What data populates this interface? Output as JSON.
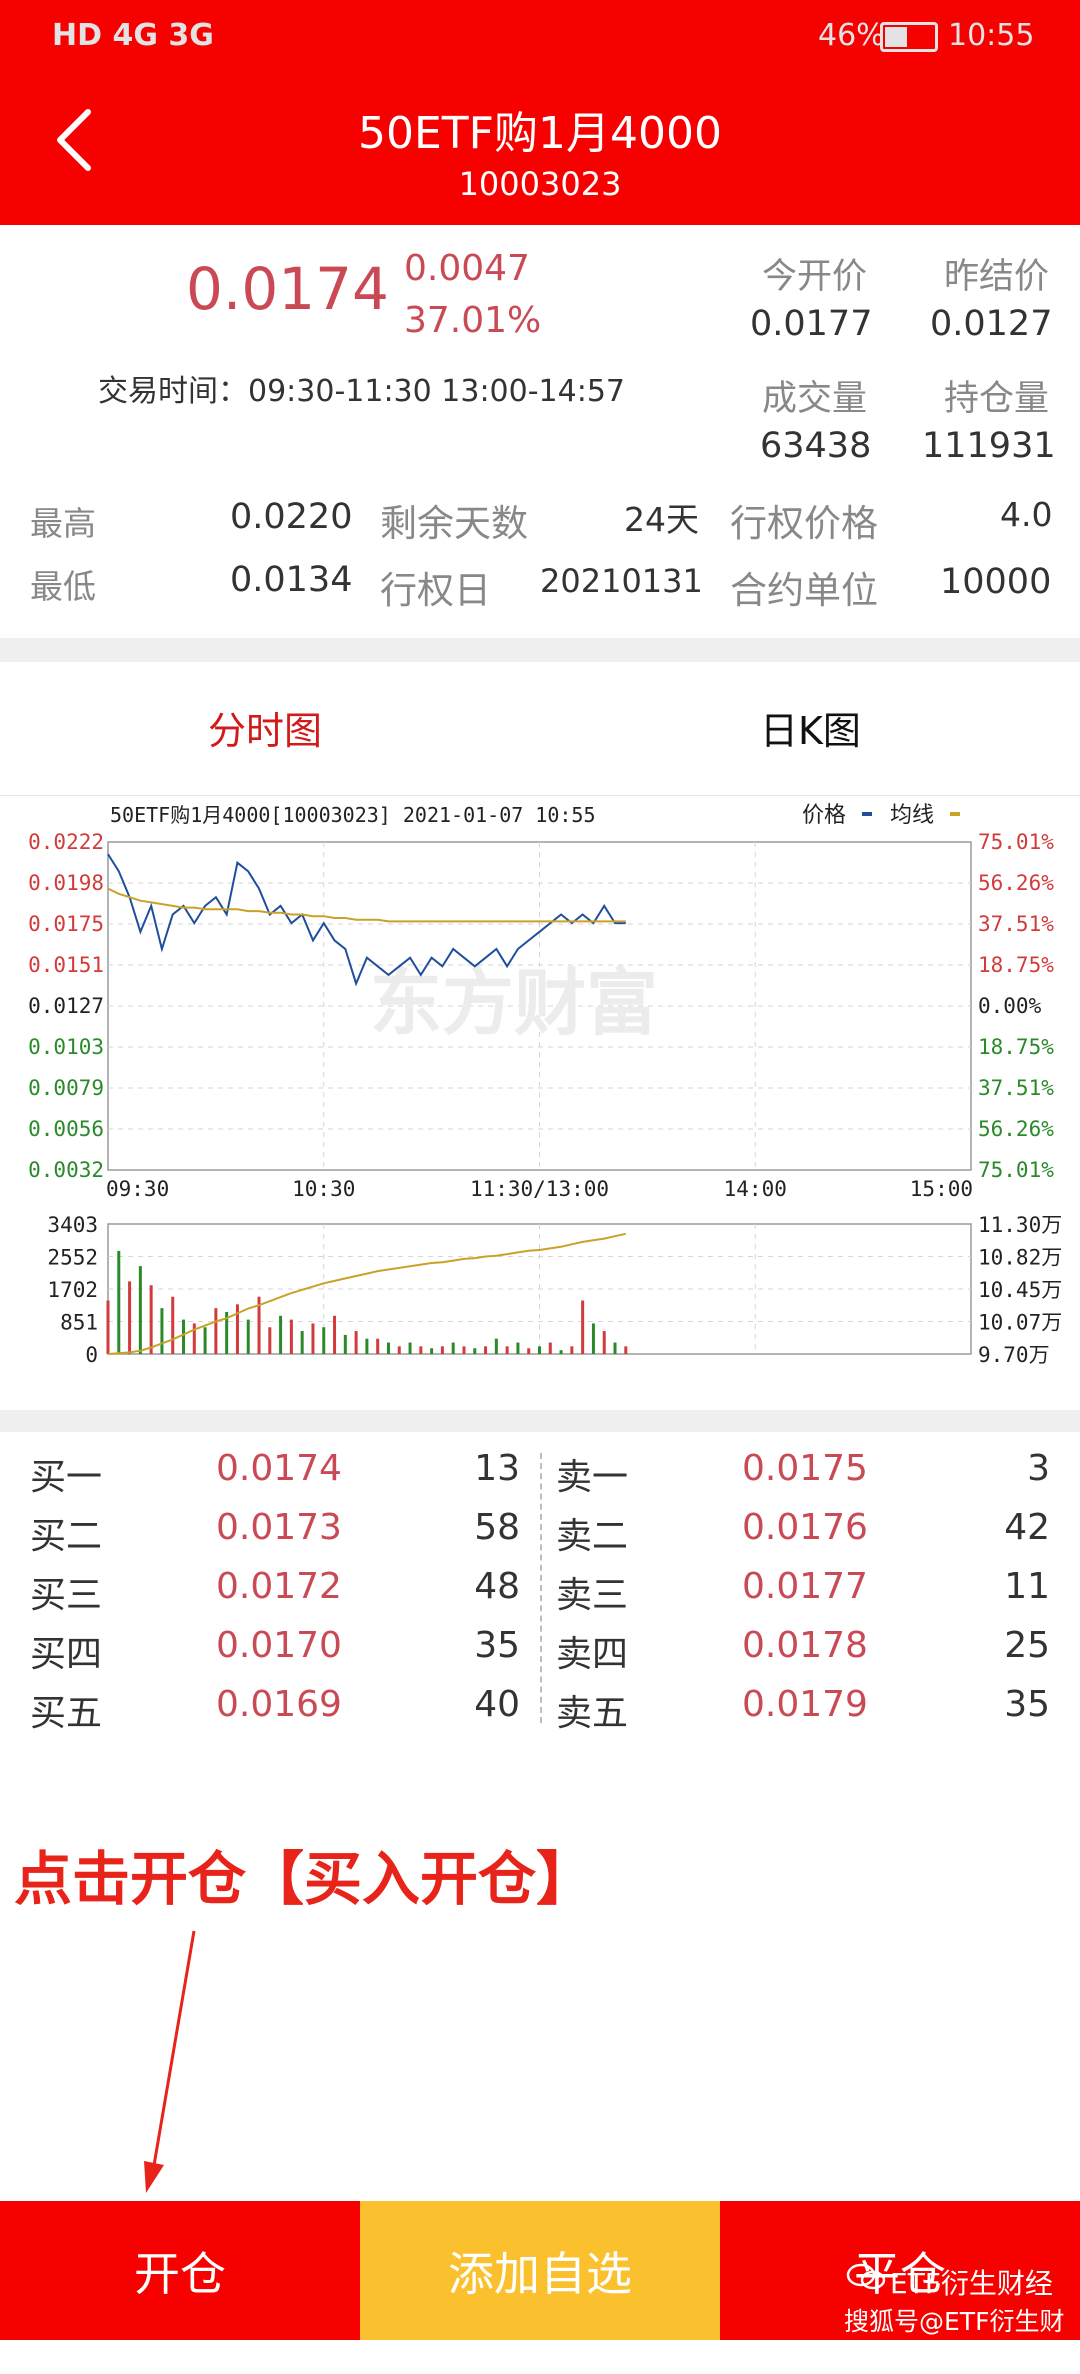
{
  "status_bar": {
    "signals": "HD 4G 3G",
    "battery": "46%",
    "time": "10:55"
  },
  "header": {
    "title": "50ETF购1月4000",
    "code": "10003023"
  },
  "quote": {
    "price": "0.0174",
    "change": "0.0047",
    "change_pct": "37.01%",
    "trade_time": "交易时间：09:30-11:30 13:00-14:57",
    "open_label": "今开价",
    "open_value": "0.0177",
    "prev_settle_label": "昨结价",
    "prev_settle_value": "0.0127",
    "volume_label": "成交量",
    "volume_value": "63438",
    "open_interest_label": "持仓量",
    "open_interest_value": "111931"
  },
  "details": {
    "high_label": "最高",
    "high_value": "0.0220",
    "low_label": "最低",
    "low_value": "0.0134",
    "days_left_label": "剩余天数",
    "days_left_value": "24天",
    "exercise_date_label": "行权日",
    "exercise_date_value": "20210131",
    "strike_label": "行权价格",
    "strike_value": "4.0",
    "unit_label": "合约单位",
    "unit_value": "10000"
  },
  "tabs": {
    "intraday": "分时图",
    "daily_k": "日K图"
  },
  "chart_header": {
    "title": "50ETF购1月4000[10003023] 2021-01-07 10:55",
    "legend_price": "价格",
    "legend_avg": "均线"
  },
  "chart_data": {
    "type": "line",
    "watermark": "东方财富",
    "x_ticks": [
      "09:30",
      "10:30",
      "11:30/13:00",
      "14:00",
      "15:00"
    ],
    "y_left_ticks": [
      "0.0222",
      "0.0198",
      "0.0175",
      "0.0151",
      "0.0127",
      "0.0103",
      "0.0079",
      "0.0056",
      "0.0032"
    ],
    "y_right_ticks": [
      "75.01%",
      "56.26%",
      "37.51%",
      "18.75%",
      "0.00%",
      "18.75%",
      "37.51%",
      "56.26%",
      "75.01%"
    ],
    "ylim": [
      0.0032,
      0.0222
    ],
    "series": [
      {
        "name": "价格",
        "color": "#1f4e9c",
        "values": [
          0.0215,
          0.0205,
          0.019,
          0.017,
          0.0185,
          0.016,
          0.018,
          0.0185,
          0.0175,
          0.0185,
          0.019,
          0.018,
          0.021,
          0.0205,
          0.0195,
          0.018,
          0.0185,
          0.0175,
          0.018,
          0.0165,
          0.0175,
          0.0165,
          0.016,
          0.014,
          0.0155,
          0.015,
          0.0145,
          0.015,
          0.0155,
          0.0145,
          0.0155,
          0.015,
          0.016,
          0.0155,
          0.015,
          0.0155,
          0.016,
          0.015,
          0.016,
          0.0165,
          0.017,
          0.0175,
          0.018,
          0.0175,
          0.018,
          0.0175,
          0.0185,
          0.0175,
          0.0175
        ]
      },
      {
        "name": "均线",
        "color": "#c9a227",
        "values": [
          0.0195,
          0.0192,
          0.019,
          0.0188,
          0.0187,
          0.0186,
          0.0185,
          0.0184,
          0.0184,
          0.0183,
          0.0183,
          0.0183,
          0.0183,
          0.0182,
          0.0182,
          0.0181,
          0.0181,
          0.018,
          0.018,
          0.0179,
          0.0179,
          0.0178,
          0.0178,
          0.0177,
          0.0177,
          0.0177,
          0.0176,
          0.0176,
          0.0176,
          0.0176,
          0.0176,
          0.0176,
          0.0176,
          0.0176,
          0.0176,
          0.0176,
          0.0176,
          0.0176,
          0.0176,
          0.0176,
          0.0176,
          0.0176,
          0.0176,
          0.0176,
          0.0176,
          0.0176,
          0.0176,
          0.0176,
          0.0176
        ]
      }
    ],
    "volume": {
      "left_ticks": [
        "3403",
        "2552",
        "1702",
        "851",
        "0"
      ],
      "right_ticks": [
        "11.30万",
        "10.82万",
        "10.45万",
        "10.07万",
        "9.70万"
      ],
      "ylim": [
        0,
        3403
      ],
      "values": [
        1400,
        2700,
        1900,
        2300,
        1800,
        1200,
        1500,
        900,
        800,
        700,
        1200,
        1100,
        1300,
        900,
        1500,
        700,
        1000,
        900,
        600,
        800,
        700,
        1000,
        500,
        600,
        400,
        400,
        300,
        200,
        300,
        200,
        150,
        200,
        300,
        200,
        150,
        200,
        400,
        200,
        300,
        150,
        200,
        300,
        100,
        200,
        1400,
        800,
        600,
        300,
        200
      ],
      "colors": [
        "r",
        "g",
        "r",
        "g",
        "r",
        "g",
        "r",
        "g",
        "r",
        "g",
        "r",
        "g",
        "r",
        "g",
        "r",
        "r",
        "g",
        "r",
        "g",
        "r",
        "g",
        "r",
        "g",
        "r",
        "g",
        "r",
        "g",
        "r",
        "g",
        "r",
        "g",
        "r",
        "g",
        "r",
        "g",
        "r",
        "g",
        "r",
        "g",
        "r",
        "g",
        "r",
        "g",
        "r",
        "r",
        "g",
        "r",
        "g",
        "r"
      ],
      "open_interest_line": [
        9.7,
        9.71,
        9.72,
        9.74,
        9.78,
        9.83,
        9.88,
        9.94,
        10.0,
        10.05,
        10.1,
        10.14,
        10.2,
        10.26,
        10.3,
        10.35,
        10.4,
        10.45,
        10.49,
        10.53,
        10.57,
        10.6,
        10.63,
        10.66,
        10.69,
        10.72,
        10.74,
        10.76,
        10.78,
        10.8,
        10.82,
        10.83,
        10.85,
        10.87,
        10.88,
        10.9,
        10.91,
        10.93,
        10.95,
        10.97,
        10.98,
        11.0,
        11.02,
        11.05,
        11.08,
        11.1,
        11.12,
        11.15,
        11.18
      ]
    }
  },
  "order_book": {
    "bids": [
      {
        "label": "买一",
        "price": "0.0174",
        "qty": "13"
      },
      {
        "label": "买二",
        "price": "0.0173",
        "qty": "58"
      },
      {
        "label": "买三",
        "price": "0.0172",
        "qty": "48"
      },
      {
        "label": "买四",
        "price": "0.0170",
        "qty": "35"
      },
      {
        "label": "买五",
        "price": "0.0169",
        "qty": "40"
      }
    ],
    "asks": [
      {
        "label": "卖一",
        "price": "0.0175",
        "qty": "3"
      },
      {
        "label": "卖二",
        "price": "0.0176",
        "qty": "42"
      },
      {
        "label": "卖三",
        "price": "0.0177",
        "qty": "11"
      },
      {
        "label": "卖四",
        "price": "0.0178",
        "qty": "25"
      },
      {
        "label": "卖五",
        "price": "0.0179",
        "qty": "35"
      }
    ]
  },
  "annotation": {
    "text": "点击开仓【买入开仓】"
  },
  "bottom_bar": {
    "open": "开仓",
    "add_watch": "添加自选",
    "close": "平仓"
  },
  "watermark": {
    "line1": "ETF衍生财经",
    "line2": "搜狐号@ETF衍生财经"
  },
  "colors": {
    "header": "#f60000",
    "up": "#c94a55",
    "down": "#2a8a2a",
    "add_watch": "#fbc02d"
  }
}
